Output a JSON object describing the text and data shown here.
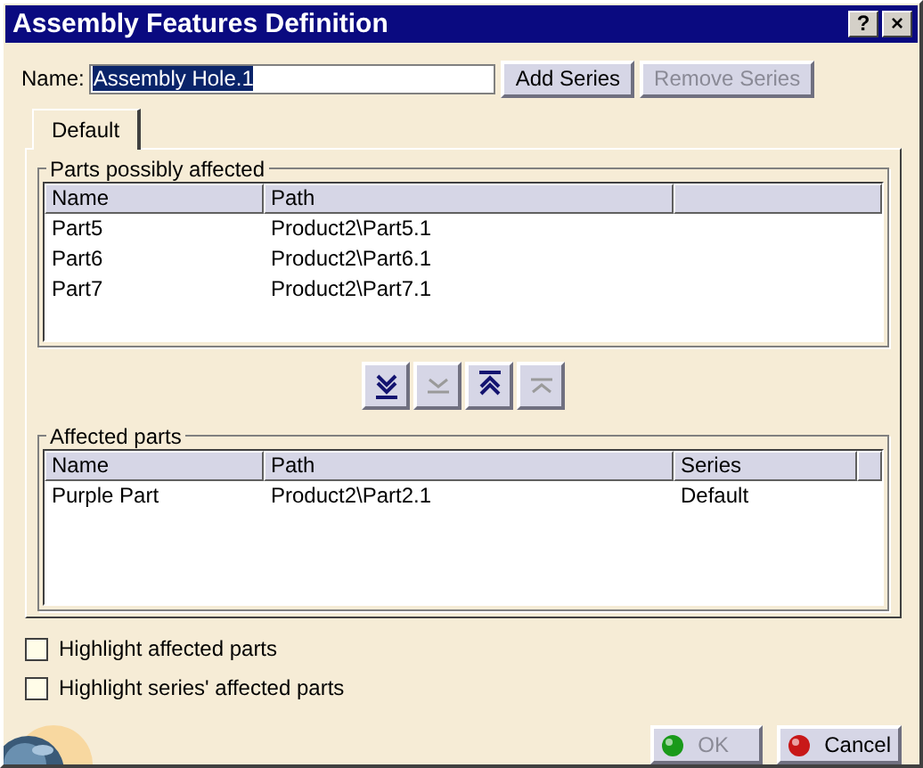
{
  "window": {
    "title": "Assembly Features Definition",
    "controls": [
      "?",
      "×"
    ]
  },
  "name_field": {
    "label": "Name:",
    "value": "Assembly Hole.1"
  },
  "series_buttons": [
    {
      "label": "Add Series",
      "disabled": false
    },
    {
      "label": "Remove Series",
      "disabled": true
    }
  ],
  "tabs": [
    {
      "label": "Default",
      "selected": true
    }
  ],
  "parts_possibly_affected": {
    "title": "Parts possibly affected",
    "columns": [
      "Name",
      "Path"
    ],
    "rows": [
      [
        "Part5",
        "Product2\\Part5.1"
      ],
      [
        "Part6",
        "Product2\\Part6.1"
      ],
      [
        "Part7",
        "Product2\\Part7.1"
      ]
    ]
  },
  "move_buttons": [
    {
      "kind": "add_all",
      "disabled": false
    },
    {
      "kind": "add",
      "disabled": true
    },
    {
      "kind": "remove_all",
      "disabled": false
    },
    {
      "kind": "remove",
      "disabled": true
    }
  ],
  "affected_parts": {
    "title": "Affected parts",
    "columns": [
      "Name",
      "Path",
      "Series"
    ],
    "rows": [
      [
        "Purple Part",
        "Product2\\Part2.1",
        "Default"
      ]
    ]
  },
  "checkboxes": [
    {
      "label": "Highlight affected parts",
      "checked": false
    },
    {
      "label": "Highlight series' affected parts",
      "checked": false
    }
  ],
  "dialog_buttons": [
    {
      "kind": "ok",
      "label": "OK",
      "disabled": true
    },
    {
      "kind": "cancel",
      "label": "Cancel",
      "disabled": false
    }
  ]
}
